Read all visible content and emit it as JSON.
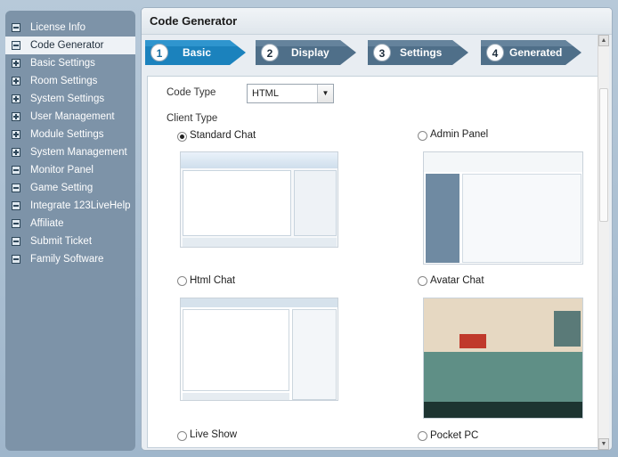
{
  "sidebar": {
    "items": [
      {
        "label": "License Info",
        "icon": "minus-icon",
        "active": false
      },
      {
        "label": "Code Generator",
        "icon": "minus-icon",
        "active": true
      },
      {
        "label": "Basic Settings",
        "icon": "plus-icon",
        "active": false
      },
      {
        "label": "Room Settings",
        "icon": "plus-icon",
        "active": false
      },
      {
        "label": "System Settings",
        "icon": "plus-icon",
        "active": false
      },
      {
        "label": "User Management",
        "icon": "plus-icon",
        "active": false
      },
      {
        "label": "Module Settings",
        "icon": "plus-icon",
        "active": false
      },
      {
        "label": "System Management",
        "icon": "plus-icon",
        "active": false
      },
      {
        "label": "Monitor Panel",
        "icon": "minus-icon",
        "active": false
      },
      {
        "label": "Game Setting",
        "icon": "minus-icon",
        "active": false
      },
      {
        "label": "Integrate 123LiveHelp",
        "icon": "minus-icon",
        "active": false
      },
      {
        "label": "Affiliate",
        "icon": "minus-icon",
        "active": false
      },
      {
        "label": "Submit Ticket",
        "icon": "minus-icon",
        "active": false
      },
      {
        "label": "Family Software",
        "icon": "minus-icon",
        "active": false
      }
    ]
  },
  "main": {
    "title": "Code Generator",
    "steps": [
      {
        "num": "1",
        "label": "Basic",
        "active": true
      },
      {
        "num": "2",
        "label": "Display",
        "active": false
      },
      {
        "num": "3",
        "label": "Settings",
        "active": false
      },
      {
        "num": "4",
        "label": "Generated",
        "active": false
      }
    ],
    "code_type_label": "Code Type",
    "code_type_value": "HTML",
    "client_type_label": "Client Type",
    "clients": [
      {
        "label": "Standard Chat",
        "checked": true,
        "thumbnail": "standard-chat-screenshot"
      },
      {
        "label": "Admin Panel",
        "checked": false,
        "thumbnail": "admin-panel-screenshot"
      },
      {
        "label": "Html Chat",
        "checked": false,
        "thumbnail": "html-chat-screenshot"
      },
      {
        "label": "Avatar Chat",
        "checked": false,
        "thumbnail": "avatar-chat-screenshot"
      },
      {
        "label": "Live Show",
        "checked": false
      },
      {
        "label": "Pocket PC",
        "checked": false
      }
    ]
  },
  "colors": {
    "sidebar_bg": "#7d93a8",
    "active_step": "#1b82bd",
    "inactive_step": "#4f6f89"
  }
}
